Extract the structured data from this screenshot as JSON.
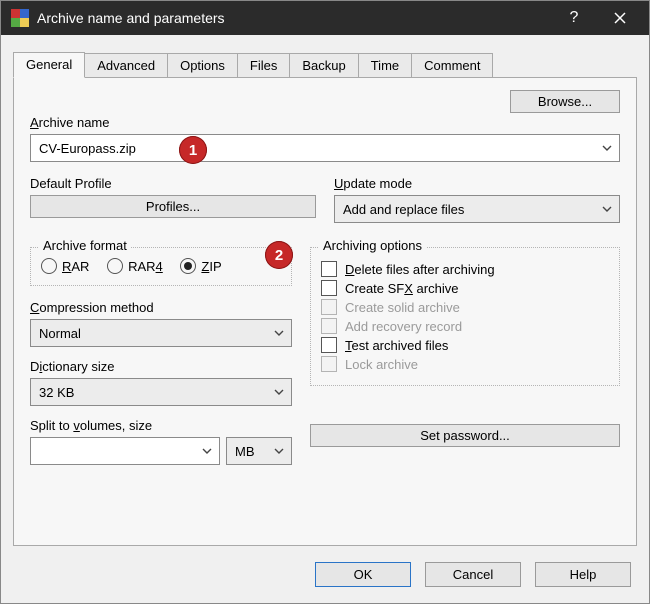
{
  "window": {
    "title": "Archive name and parameters"
  },
  "tabs": [
    "General",
    "Advanced",
    "Options",
    "Files",
    "Backup",
    "Time",
    "Comment"
  ],
  "browse": "Browse...",
  "archive_name": {
    "label": "Archive name",
    "u": "A",
    "value": "CV-Europass.zip"
  },
  "default_profile": {
    "label": "Default Profile",
    "button": "Profiles..."
  },
  "update_mode": {
    "label": "Update mode",
    "u": "U",
    "value": "Add and replace files"
  },
  "archive_format": {
    "legend": "Archive format",
    "rar": {
      "label": "RAR",
      "u": "R"
    },
    "rar4": {
      "label": "RAR4",
      "u": "4"
    },
    "zip": {
      "label": "ZIP",
      "u": "Z"
    }
  },
  "compression": {
    "label": "Compression method",
    "u": "C",
    "value": "Normal"
  },
  "dictionary": {
    "label": "Dictionary size",
    "u": "i",
    "value": "32 KB"
  },
  "split": {
    "label": "Split to volumes, size",
    "u": "v",
    "value": "",
    "unit": "MB"
  },
  "options": {
    "legend": "Archiving options",
    "delete": {
      "label": "Delete files after archiving",
      "u": "D"
    },
    "sfx": {
      "label": "Create SFX archive",
      "u": "X"
    },
    "solid": "Create solid archive",
    "recovery": "Add recovery record",
    "test": {
      "label": "Test archived files",
      "u": "T"
    },
    "lock": "Lock archive"
  },
  "set_password": "Set password...",
  "footer": {
    "ok": "OK",
    "cancel": "Cancel",
    "help": "Help"
  },
  "markers": {
    "one": "1",
    "two": "2"
  }
}
